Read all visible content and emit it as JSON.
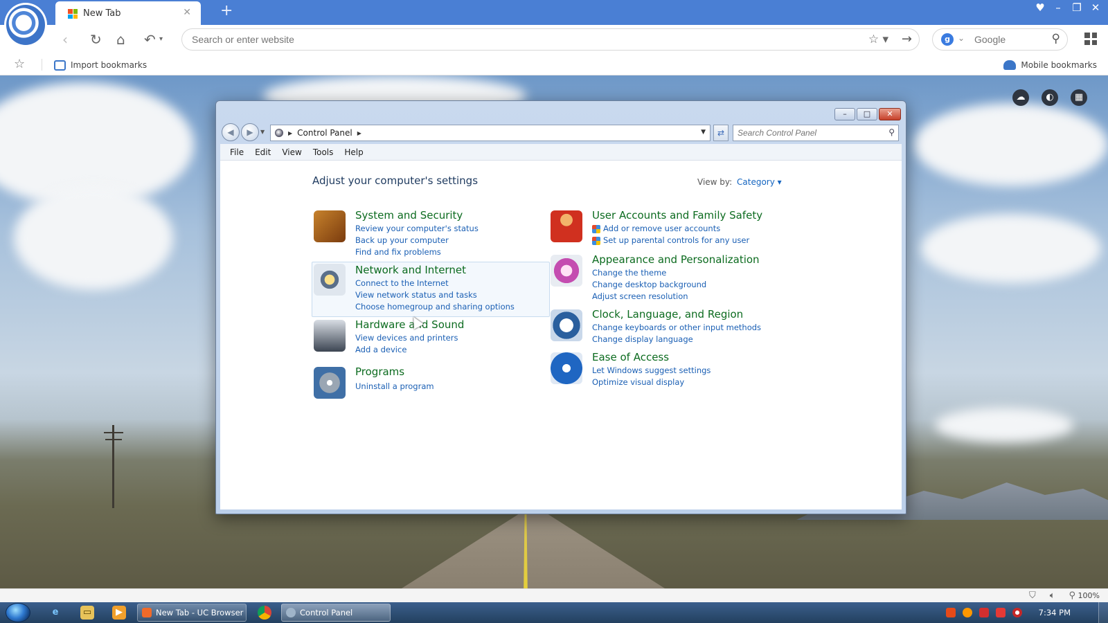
{
  "browser": {
    "tab_title": "New Tab",
    "new_tab_icon": "plus-icon",
    "address_placeholder": "Search or enter website",
    "search_engine_label": "Google",
    "bookmarks_import": "Import bookmarks",
    "bookmarks_mobile": "Mobile bookmarks"
  },
  "control_panel": {
    "breadcrumb": [
      "Control Panel"
    ],
    "search_placeholder": "Search Control Panel",
    "menu": [
      "File",
      "Edit",
      "View",
      "Tools",
      "Help"
    ],
    "heading": "Adjust your computer's settings",
    "view_by_label": "View by:",
    "view_by_value": "Category",
    "categories": [
      {
        "title": "System and Security",
        "links": [
          "Review your computer's status",
          "Back up your computer",
          "Find and fix problems"
        ]
      },
      {
        "title": "Network and Internet",
        "links": [
          "Connect to the Internet",
          "View network status and tasks",
          "Choose homegroup and sharing options"
        ]
      },
      {
        "title": "Hardware and Sound",
        "links": [
          "View devices and printers",
          "Add a device"
        ]
      },
      {
        "title": "Programs",
        "links": [
          "Uninstall a program"
        ]
      },
      {
        "title": "User Accounts and Family Safety",
        "links": [
          "Add or remove user accounts",
          "Set up parental controls for any user"
        ]
      },
      {
        "title": "Appearance and Personalization",
        "links": [
          "Change the theme",
          "Change desktop background",
          "Adjust screen resolution"
        ]
      },
      {
        "title": "Clock, Language, and Region",
        "links": [
          "Change keyboards or other input methods",
          "Change display language"
        ]
      },
      {
        "title": "Ease of Access",
        "links": [
          "Let Windows suggest settings",
          "Optimize visual display"
        ]
      }
    ]
  },
  "status_bar": {
    "zoom": "100%"
  },
  "taskbar": {
    "tasks": [
      "New Tab - UC Browser",
      "Control Panel"
    ],
    "clock": "7:34 PM"
  },
  "colors": {
    "link": "#1a5fb4",
    "category_title": "#0c6b1f",
    "browser_accent": "#4a7fd4"
  }
}
